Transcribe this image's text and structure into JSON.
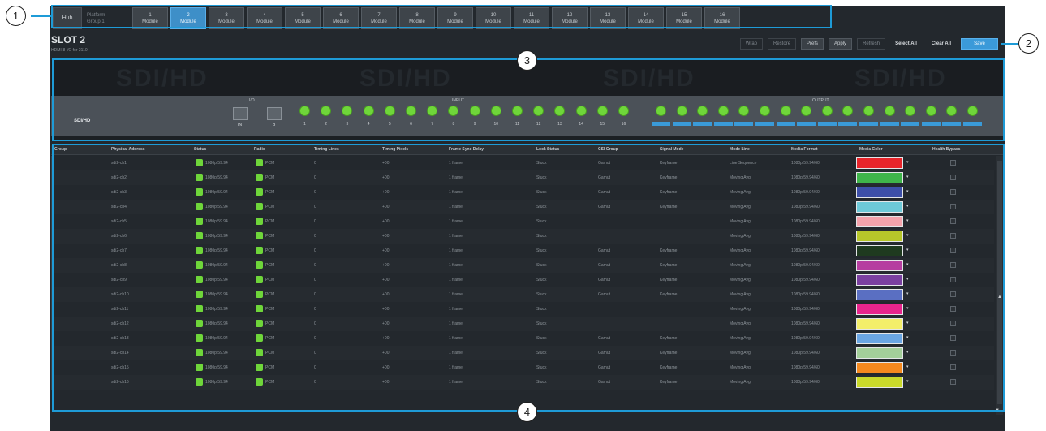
{
  "slot_bar": {
    "home_label": "Hub",
    "group_label": [
      "Platform",
      "Group 1"
    ],
    "slots": [
      {
        "num": "1",
        "label": "Module",
        "active": false
      },
      {
        "num": "2",
        "label": "Module",
        "active": true
      },
      {
        "num": "3",
        "label": "Module",
        "active": false
      },
      {
        "num": "4",
        "label": "Module",
        "active": false
      },
      {
        "num": "5",
        "label": "Module",
        "active": false
      },
      {
        "num": "6",
        "label": "Module",
        "active": false
      },
      {
        "num": "7",
        "label": "Module",
        "active": false
      },
      {
        "num": "8",
        "label": "Module",
        "active": false
      },
      {
        "num": "9",
        "label": "Module",
        "active": false
      },
      {
        "num": "10",
        "label": "Module",
        "active": false
      },
      {
        "num": "11",
        "label": "Module",
        "active": false
      },
      {
        "num": "12",
        "label": "Module",
        "active": false
      },
      {
        "num": "13",
        "label": "Module",
        "active": false
      },
      {
        "num": "14",
        "label": "Module",
        "active": false
      },
      {
        "num": "15",
        "label": "Module",
        "active": false
      },
      {
        "num": "16",
        "label": "Module",
        "active": false
      }
    ]
  },
  "header": {
    "title": "SLOT 2",
    "subtitle": "HDMI-8 I/O for 2110"
  },
  "toolbar": {
    "buttons": [
      {
        "label": "Wrap",
        "style": "ghost"
      },
      {
        "label": "Restore",
        "style": "ghost"
      },
      {
        "label": "Prefs",
        "style": "normal"
      },
      {
        "label": "Apply",
        "style": "normal"
      },
      {
        "label": "Refresh",
        "style": "ghost"
      },
      {
        "label": "Select All",
        "style": "plain"
      },
      {
        "label": "Clear All",
        "style": "plain"
      },
      {
        "label": "Save",
        "style": "primary"
      }
    ]
  },
  "module_panel": {
    "name": "SDI/HD",
    "section_io": "I/O",
    "section_input": "INPUT",
    "section_output": "OUTPUT",
    "io_labels": [
      "IN",
      "B"
    ],
    "input_numbers": [
      "1",
      "2",
      "3",
      "4",
      "5",
      "6",
      "7",
      "8",
      "9",
      "10",
      "11",
      "12",
      "13",
      "14",
      "15",
      "16"
    ],
    "output_count": 16
  },
  "table": {
    "columns": [
      "Group",
      "Physical Address",
      "Status",
      "Radio",
      "Timing Lines",
      "Timing Pixels",
      "Frame Sync Delay",
      "Lock Status",
      "CSI Group",
      "Signal Mode",
      "Mode Line",
      "Media Format",
      "Media Color",
      "Health Bypass"
    ],
    "rows": [
      {
        "addr": "sdi2-ch1",
        "status": "1080p 59.94",
        "radio": "PCM",
        "lines": "0",
        "pixels": "+00",
        "delay": "1 frame",
        "lock": "Stuck",
        "csi": "Gamut",
        "signal": "Keyframe",
        "mode": "Line Sequence",
        "format": "1080p 59.94/60",
        "color": "#e8242a"
      },
      {
        "addr": "sdi2-ch2",
        "status": "1080p 59.94",
        "radio": "PCM",
        "lines": "0",
        "pixels": "+00",
        "delay": "1 frame",
        "lock": "Stuck",
        "csi": "Gamut",
        "signal": "Keyframe",
        "mode": "Moving Avg",
        "format": "1080p 59.94/60",
        "color": "#3fb54a"
      },
      {
        "addr": "sdi2-ch3",
        "status": "1080p 59.94",
        "radio": "PCM",
        "lines": "0",
        "pixels": "+00",
        "delay": "1 frame",
        "lock": "Stuck",
        "csi": "Gamut",
        "signal": "Keyframe",
        "mode": "Moving Avg",
        "format": "1080p 59.94/60",
        "color": "#3d4fa8"
      },
      {
        "addr": "sdi2-ch4",
        "status": "1080p 59.94",
        "radio": "PCM",
        "lines": "0",
        "pixels": "+00",
        "delay": "1 frame",
        "lock": "Stuck",
        "csi": "Gamut",
        "signal": "Keyframe",
        "mode": "Moving Avg",
        "format": "1080p 59.94/60",
        "color": "#6dc9d8"
      },
      {
        "addr": "sdi2-ch5",
        "status": "1080p 59.94",
        "radio": "PCM",
        "lines": "0",
        "pixels": "+00",
        "delay": "1 frame",
        "lock": "Stuck",
        "csi": "",
        "signal": "",
        "mode": "Moving Avg",
        "format": "1080p 59.94/60",
        "color": "#f4a3ac"
      },
      {
        "addr": "sdi2-ch6",
        "status": "1080p 59.94",
        "radio": "PCM",
        "lines": "0",
        "pixels": "+00",
        "delay": "1 frame",
        "lock": "Stuck",
        "csi": "",
        "signal": "",
        "mode": "Moving Avg",
        "format": "1080p 59.94/60",
        "color": "#b6c62a"
      },
      {
        "addr": "sdi2-ch7",
        "status": "1080p 59.94",
        "radio": "PCM",
        "lines": "0",
        "pixels": "+00",
        "delay": "1 frame",
        "lock": "Stuck",
        "csi": "Gamut",
        "signal": "Keyframe",
        "mode": "Moving Avg",
        "format": "1080p 59.94/60",
        "color": "#1f3a1f"
      },
      {
        "addr": "sdi2-ch8",
        "status": "1080p 59.94",
        "radio": "PCM",
        "lines": "0",
        "pixels": "+00",
        "delay": "1 frame",
        "lock": "Stuck",
        "csi": "Gamut",
        "signal": "Keyframe",
        "mode": "Moving Avg",
        "format": "1080p 59.94/60",
        "color": "#b63ea0"
      },
      {
        "addr": "sdi2-ch9",
        "status": "1080p 59.94",
        "radio": "PCM",
        "lines": "0",
        "pixels": "+00",
        "delay": "1 frame",
        "lock": "Stuck",
        "csi": "Gamut",
        "signal": "Keyframe",
        "mode": "Moving Avg",
        "format": "1080p 59.94/60",
        "color": "#7a3fa0"
      },
      {
        "addr": "sdi2-ch10",
        "status": "1080p 59.94",
        "radio": "PCM",
        "lines": "0",
        "pixels": "+00",
        "delay": "1 frame",
        "lock": "Stuck",
        "csi": "Gamut",
        "signal": "Keyframe",
        "mode": "Moving Avg",
        "format": "1080p 59.94/60",
        "color": "#5a6fc2"
      },
      {
        "addr": "sdi2-ch11",
        "status": "1080p 59.94",
        "radio": "PCM",
        "lines": "0",
        "pixels": "+00",
        "delay": "1 frame",
        "lock": "Stuck",
        "csi": "",
        "signal": "",
        "mode": "Moving Avg",
        "format": "1080p 59.94/60",
        "color": "#e8258c"
      },
      {
        "addr": "sdi2-ch12",
        "status": "1080p 59.94",
        "radio": "PCM",
        "lines": "0",
        "pixels": "+00",
        "delay": "1 frame",
        "lock": "Stuck",
        "csi": "",
        "signal": "",
        "mode": "Moving Avg",
        "format": "1080p 59.94/60",
        "color": "#f3ee6a"
      },
      {
        "addr": "sdi2-ch13",
        "status": "1080p 59.94",
        "radio": "PCM",
        "lines": "0",
        "pixels": "+00",
        "delay": "1 frame",
        "lock": "Stuck",
        "csi": "Gamut",
        "signal": "Keyframe",
        "mode": "Moving Avg",
        "format": "1080p 59.94/60",
        "color": "#6aa6e3"
      },
      {
        "addr": "sdi2-ch14",
        "status": "1080p 59.94",
        "radio": "PCM",
        "lines": "0",
        "pixels": "+00",
        "delay": "1 frame",
        "lock": "Stuck",
        "csi": "Gamut",
        "signal": "Keyframe",
        "mode": "Moving Avg",
        "format": "1080p 59.94/60",
        "color": "#a3cf9a"
      },
      {
        "addr": "sdi2-ch15",
        "status": "1080p 59.94",
        "radio": "PCM",
        "lines": "0",
        "pixels": "+00",
        "delay": "1 frame",
        "lock": "Stuck",
        "csi": "Gamut",
        "signal": "Keyframe",
        "mode": "Moving Avg",
        "format": "1080p 59.94/60",
        "color": "#f5891e"
      },
      {
        "addr": "sdi2-ch16",
        "status": "1080p 59.94",
        "radio": "PCM",
        "lines": "0",
        "pixels": "+00",
        "delay": "1 frame",
        "lock": "Stuck",
        "csi": "Gamut",
        "signal": "Keyframe",
        "mode": "Moving Avg",
        "format": "1080p 59.94/60",
        "color": "#c9d92a"
      }
    ]
  },
  "callouts": [
    "1",
    "2",
    "3",
    "4"
  ],
  "colors": {
    "accent": "#1e9bd7",
    "background": "#23282d",
    "status_ok": "#6fd63a",
    "active_slot": "#3e8fc8"
  }
}
